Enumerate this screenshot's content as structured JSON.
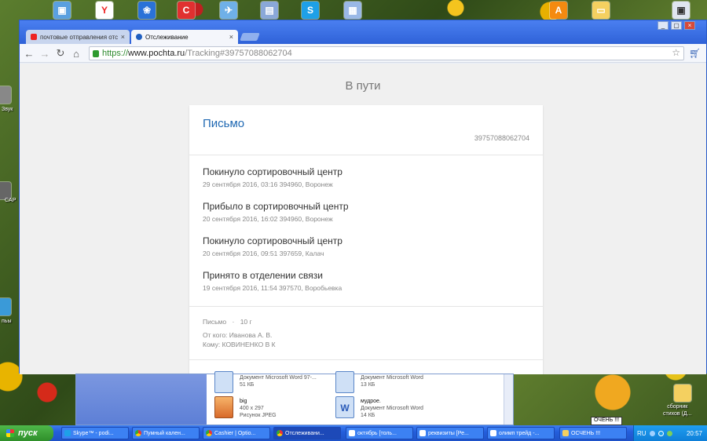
{
  "browser": {
    "tabs": [
      {
        "label": "почтовые отправления отс",
        "close": "×"
      },
      {
        "label": "Отслеживание",
        "close": "×"
      }
    ],
    "url": {
      "scheme": "https://",
      "host": "www.pochta.ru",
      "path": "/Tracking#39757088062704"
    }
  },
  "page": {
    "status_heading": "В пути",
    "card": {
      "title": "Письмо",
      "tracking_number": "39757088062704",
      "events": [
        {
          "title": "Покинуло сортировочный центр",
          "meta": "29 сентября 2016, 03:16 394960, Воронеж"
        },
        {
          "title": "Прибыло в сортировочный центр",
          "meta": "20 сентября 2016, 16:02 394960, Воронеж"
        },
        {
          "title": "Покинуло сортировочный центр",
          "meta": "20 сентября 2016, 09:51 397659, Калач"
        },
        {
          "title": "Принято в отделении связи",
          "meta": "19 сентября 2016, 11:54 397570, Воробьевка"
        }
      ],
      "info": {
        "type": "Письмо",
        "separator": "·",
        "weight": "10 г",
        "from": "От кого: Иванова А. В.",
        "to": "Кому: КОВИНЕНКО В К"
      }
    }
  },
  "explorer": {
    "files": [
      {
        "name": "",
        "type": "Документ Microsoft Word 97-...",
        "size": "51 КБ"
      },
      {
        "name": "",
        "type": "Документ Microsoft Word",
        "size": "13 КБ"
      },
      {
        "name": "big",
        "type": "400 x 297",
        "size": "Рисунок JPEG"
      },
      {
        "name": "мудрое.",
        "type": "Документ Microsoft Word",
        "size": "14 КБ"
      }
    ]
  },
  "desktop": {
    "tooltip": "ОЧЕНЬ !!!",
    "right_label_1": "сборник",
    "right_label_2": "стихов (Д...",
    "left_labels": [
      "Звук",
      "CAP",
      "пьы"
    ]
  },
  "taskbar": {
    "start": "пуск",
    "tasks": [
      {
        "label": "Skype™ - podi..."
      },
      {
        "label": "Пумный кален..."
      },
      {
        "label": "Cashier | Optio..."
      },
      {
        "label": "Отслеживани..."
      },
      {
        "label": "октябрь [толь..."
      },
      {
        "label": "реквизиты [Ре..."
      },
      {
        "label": "олимп трейд -..."
      },
      {
        "label": "ОСЧЕНЬ !!!"
      }
    ],
    "lang": "RU",
    "clock": "20:57"
  },
  "colors": {
    "accent": "#2069b3",
    "taskbar": "#245fdc",
    "start": "#3a9e34"
  }
}
